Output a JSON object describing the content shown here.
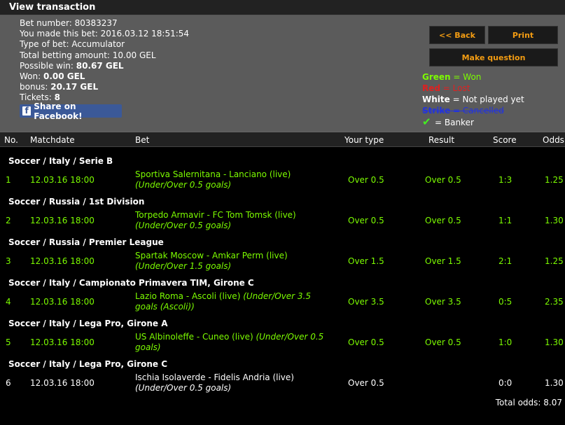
{
  "header": {
    "title": "View transaction"
  },
  "info": {
    "bet_number": "Bet number: 80383237",
    "made_bet": "You made this bet: 2016.03.12 18:51:54",
    "type_of_bet": "Type of bet: Accumulator",
    "total_betting": "Total betting amount: 10.00 GEL",
    "possible_win_label": "Possible win: ",
    "possible_win_value": "80.67 GEL",
    "won_label": "Won: ",
    "won_value": "0.00 GEL",
    "bonus_label": "bonus: ",
    "bonus_value": "20.17 GEL",
    "tickets_label": "Tickets: ",
    "tickets_value": "8",
    "facebook_label": "Share on Facebook!"
  },
  "actions": {
    "back_label": "<< Back",
    "print_label": "Print",
    "question_label": "Make question"
  },
  "legend": {
    "green_word": "Green",
    "green_rest": " = Won",
    "red_word": "Red",
    "red_rest": " = Lost",
    "white_word": "White",
    "white_rest": " = Not played yet",
    "strike_word": "Strike",
    "strike_rest": " = Cancelled",
    "banker_rest": "= Banker",
    "colors": {
      "won": "#7CFC00",
      "lost": "#e02020",
      "cancelled": "#2233dd"
    }
  },
  "table": {
    "columns": [
      "No.",
      "Matchdate",
      "Bet",
      "Your type",
      "Result",
      "Score",
      "Odds"
    ],
    "rows": [
      {
        "league": "Soccer / Italy / Serie B",
        "no": "1",
        "date": "12.03.16 18:00",
        "match": "Sportiva Salernitana - Lanciano (live)",
        "market": "(Under/Over 0.5 goals)",
        "your_type": "Over 0.5",
        "result": "Over 0.5",
        "score": "1:3",
        "odds": "1.25",
        "status": "won"
      },
      {
        "league": "Soccer / Russia / 1st Division",
        "no": "2",
        "date": "12.03.16 18:00",
        "match": "Torpedo Armavir - FC Tom Tomsk (live)",
        "market": "(Under/Over 0.5 goals)",
        "your_type": "Over 0.5",
        "result": "Over 0.5",
        "score": "1:1",
        "odds": "1.30",
        "status": "won"
      },
      {
        "league": "Soccer / Russia / Premier League",
        "no": "3",
        "date": "12.03.16 18:00",
        "match": "Spartak Moscow - Amkar Perm (live)",
        "market": "(Under/Over 1.5 goals)",
        "your_type": "Over 1.5",
        "result": "Over 1.5",
        "score": "2:1",
        "odds": "1.25",
        "status": "won"
      },
      {
        "league": "Soccer / Italy / Campionato Primavera TIM, Girone C",
        "no": "4",
        "date": "12.03.16 18:00",
        "match": "Lazio Roma - Ascoli (live)",
        "market": "(Under/Over 3.5 goals (Ascoli))",
        "your_type": "Over 3.5",
        "result": "Over 3.5",
        "score": "0:5",
        "odds": "2.35",
        "status": "won"
      },
      {
        "league": "Soccer / Italy / Lega Pro, Girone A",
        "no": "5",
        "date": "12.03.16 18:00",
        "match": "US Albinoleffe - Cuneo (live)",
        "market": "(Under/Over 0.5 goals)",
        "your_type": "Over 0.5",
        "result": "Over 0.5",
        "score": "1:0",
        "odds": "1.30",
        "status": "won"
      },
      {
        "league": "Soccer / Italy / Lega Pro, Girone C",
        "no": "6",
        "date": "12.03.16 18:00",
        "match": "Ischia Isolaverde - Fidelis Andria (live)",
        "market": "(Under/Over 0.5 goals)",
        "your_type": "Over 0.5",
        "result": "",
        "score": "0:0",
        "odds": "1.30",
        "status": "unplayed"
      }
    ],
    "total_odds": "Total odds: 8.07"
  }
}
